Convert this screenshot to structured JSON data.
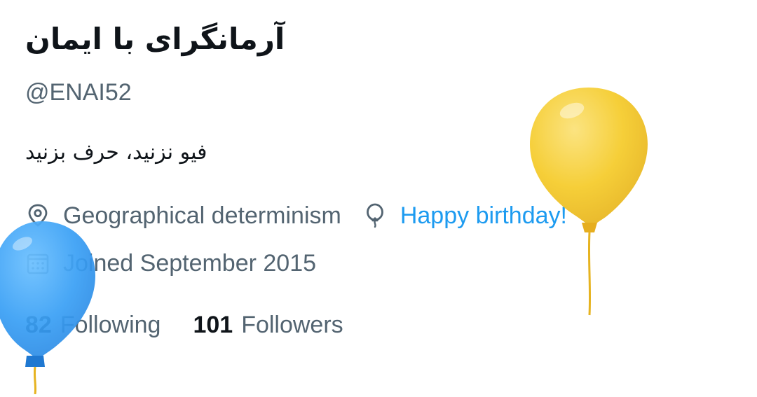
{
  "profile": {
    "display_name": "آرمانگرای با ایمان",
    "handle": "@ENAI52",
    "bio": "فیو نزنید، حرف بزنید"
  },
  "meta": {
    "location": "Geographical determinism",
    "location_icon": "location-pin-icon",
    "birthday": "Happy birthday!",
    "birthday_icon": "balloon-icon",
    "joined": "Joined September 2015",
    "joined_icon": "calendar-icon"
  },
  "stats": {
    "following_count": "82",
    "following_label": "Following",
    "followers_count": "101",
    "followers_label": "Followers"
  },
  "decorations": {
    "balloons": [
      "yellow-balloon",
      "blue-balloon"
    ]
  },
  "colors": {
    "text_primary": "#0f1419",
    "text_secondary": "#536471",
    "link": "#1d9bf0",
    "balloon_yellow": "#f5cc2e",
    "balloon_blue": "#3aa0f5"
  }
}
